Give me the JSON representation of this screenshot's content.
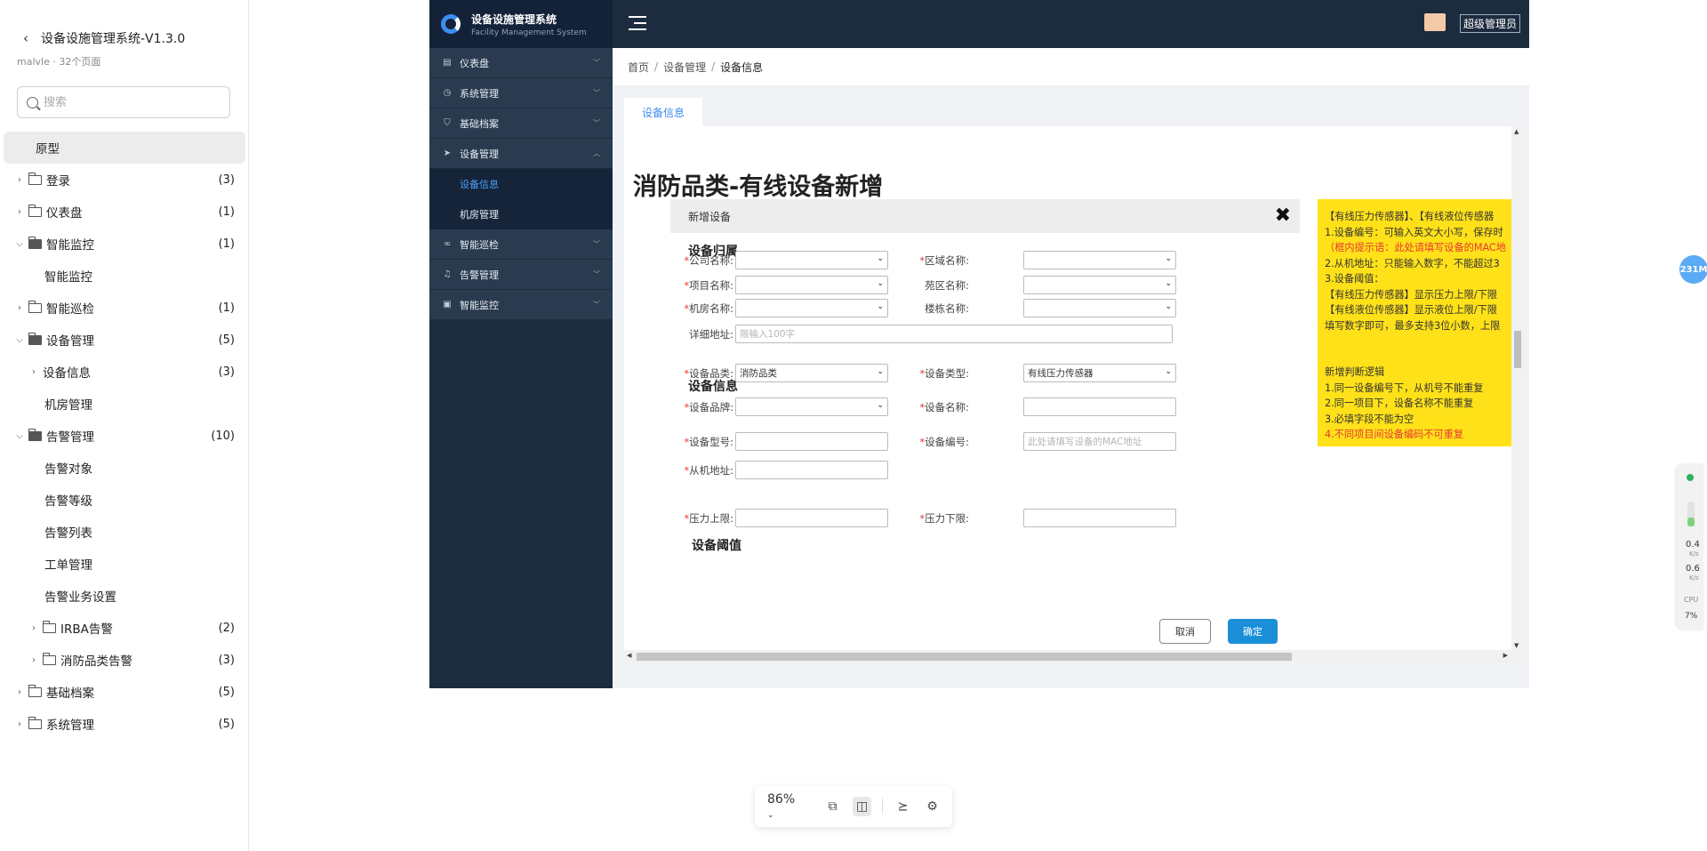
{
  "project": {
    "title": "设备设施管理系统-V1.3.0",
    "subtitle": "malvle · 32个页面",
    "search_placeholder": "搜索",
    "tree": [
      {
        "label": "原型",
        "count": "",
        "level": 0,
        "type": "page",
        "selected": true
      },
      {
        "label": "登录",
        "count": "(3)",
        "level": 0,
        "type": "folder",
        "expanded": false
      },
      {
        "label": "仪表盘",
        "count": "(1)",
        "level": 0,
        "type": "folder",
        "expanded": false
      },
      {
        "label": "智能监控",
        "count": "(1)",
        "level": 0,
        "type": "folder",
        "expanded": true
      },
      {
        "label": "智能监控",
        "count": "",
        "level": 1,
        "type": "page"
      },
      {
        "label": "智能巡检",
        "count": "(1)",
        "level": 0,
        "type": "folder",
        "expanded": false
      },
      {
        "label": "设备管理",
        "count": "(5)",
        "level": 0,
        "type": "folder",
        "expanded": true
      },
      {
        "label": "设备信息",
        "count": "(3)",
        "level": 1,
        "type": "page-group",
        "expanded": false
      },
      {
        "label": "机房管理",
        "count": "",
        "level": 1,
        "type": "page"
      },
      {
        "label": "告警管理",
        "count": "(10)",
        "level": 0,
        "type": "folder",
        "expanded": true
      },
      {
        "label": "告警对象",
        "count": "",
        "level": 1,
        "type": "page"
      },
      {
        "label": "告警等级",
        "count": "",
        "level": 1,
        "type": "page"
      },
      {
        "label": "告警列表",
        "count": "",
        "level": 1,
        "type": "page"
      },
      {
        "label": "工单管理",
        "count": "",
        "level": 1,
        "type": "page"
      },
      {
        "label": "告警业务设置",
        "count": "",
        "level": 1,
        "type": "page"
      },
      {
        "label": "IRBA告警",
        "count": "(2)",
        "level": 1,
        "type": "folder",
        "expanded": false
      },
      {
        "label": "消防品类告警",
        "count": "(3)",
        "level": 1,
        "type": "folder",
        "expanded": false
      },
      {
        "label": "基础档案",
        "count": "(5)",
        "level": 0,
        "type": "folder",
        "expanded": false
      },
      {
        "label": "系统管理",
        "count": "(5)",
        "level": 0,
        "type": "folder",
        "expanded": false
      }
    ]
  },
  "app": {
    "name": "设备设施管理系统",
    "name_en": "Facility Management System",
    "user": "超级管理员",
    "menu": [
      {
        "label": "仪表盘",
        "icon": "dashboard-icon",
        "glyph": "▤",
        "expanded": false
      },
      {
        "label": "系统管理",
        "icon": "clock-icon",
        "glyph": "◷",
        "expanded": false
      },
      {
        "label": "基础档案",
        "icon": "shield-icon",
        "glyph": "⛉",
        "expanded": false
      },
      {
        "label": "设备管理",
        "icon": "send-icon",
        "glyph": "➤",
        "expanded": true,
        "children": [
          {
            "label": "设备信息",
            "active": true
          },
          {
            "label": "机房管理",
            "active": false
          }
        ]
      },
      {
        "label": "智能巡检",
        "icon": "infinity-icon",
        "glyph": "∞",
        "expanded": false
      },
      {
        "label": "告警管理",
        "icon": "bell-icon",
        "glyph": "♫",
        "expanded": false
      },
      {
        "label": "智能监控",
        "icon": "monitor-icon",
        "glyph": "▣",
        "expanded": false
      }
    ],
    "breadcrumb": [
      "首页",
      "设备管理",
      "设备信息"
    ],
    "tab": "设备信息"
  },
  "page": {
    "title": "消防品类-有线设备新增",
    "dialog": {
      "title": "新增设备",
      "sections": {
        "ownership": "设备归属",
        "info": "设备信息",
        "threshold": "设备阈值"
      },
      "fields": {
        "company": {
          "label": "公司名称:",
          "required": true,
          "value": ""
        },
        "region": {
          "label": "区域名称:",
          "required": true,
          "value": ""
        },
        "project": {
          "label": "项目名称:",
          "required": true,
          "value": ""
        },
        "park": {
          "label": "苑区名称:",
          "required": false,
          "value": ""
        },
        "room": {
          "label": "机房名称:",
          "required": true,
          "value": ""
        },
        "building": {
          "label": "楼栋名称:",
          "required": false,
          "value": ""
        },
        "address": {
          "label": "详细地址:",
          "required": false,
          "placeholder": "限输入100字"
        },
        "category": {
          "label": "设备品类:",
          "required": true,
          "value": "消防品类"
        },
        "type": {
          "label": "设备类型:",
          "required": true,
          "value": "有线压力传感器"
        },
        "brand": {
          "label": "设备品牌:",
          "required": true,
          "value": ""
        },
        "name": {
          "label": "设备名称:",
          "required": true,
          "value": ""
        },
        "model": {
          "label": "设备型号:",
          "required": true,
          "value": ""
        },
        "code": {
          "label": "设备编号:",
          "required": true,
          "placeholder": "此处请填写设备的MAC地址"
        },
        "slave": {
          "label": "从机地址:",
          "required": true,
          "value": ""
        },
        "upper": {
          "label": "压力上限:",
          "required": true,
          "value": ""
        },
        "lower": {
          "label": "压力下限:",
          "required": true,
          "value": ""
        }
      },
      "buttons": {
        "cancel": "取消",
        "ok": "确定"
      }
    },
    "note": [
      {
        "text": "【有线压力传感器】、【有线液位传感器",
        "red": false
      },
      {
        "text": "1.设备编号：可输入英文大小写，保存时",
        "red": false
      },
      {
        "text": "（框内提示语：此处请填写设备的MAC地",
        "red": true
      },
      {
        "text": "2.从机地址：只能输入数字，不能超过3",
        "red": false
      },
      {
        "text": "3.设备阈值：",
        "red": false
      },
      {
        "text": "【有线压力传感器】显示压力上限/下限",
        "red": false
      },
      {
        "text": "【有线液位传感器】显示液位上限/下限",
        "red": false
      },
      {
        "text": "填写数字即可，最多支持3位小数，上限",
        "red": false
      },
      {
        "text": "",
        "red": false
      },
      {
        "text": "",
        "red": false
      },
      {
        "text": "新增判断逻辑",
        "red": false
      },
      {
        "text": "1.同一设备编号下，从机号不能重复",
        "red": false
      },
      {
        "text": "2.同一项目下，设备名称不能重复",
        "red": false
      },
      {
        "text": "3.必填字段不能为空",
        "red": false
      },
      {
        "text": "4.不同项目间设备编码不可重复",
        "red": true
      }
    ]
  },
  "toolbar": {
    "zoom": "86%"
  },
  "widgets": {
    "memory": "231M",
    "upload": "0.4",
    "upload_unit": "K/s",
    "download": "0.6",
    "download_unit": "K/s",
    "cpu_label": "CPU",
    "cpu": "7%"
  },
  "colors": {
    "accent": "#3d8cf0",
    "sidebar": "#1d2b3e",
    "note_bg": "#ffe119",
    "required": "#e53935",
    "ok_button": "#1a8fd8"
  }
}
